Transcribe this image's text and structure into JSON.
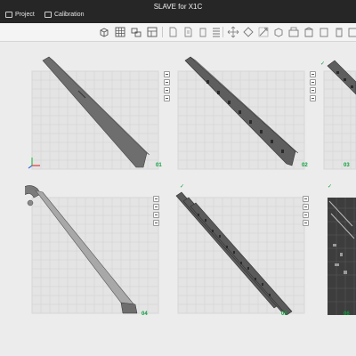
{
  "window": {
    "title": "SLAVE for X1C"
  },
  "tabs": [
    {
      "label": "Project"
    },
    {
      "label": "Calibration"
    }
  ],
  "plates": [
    {
      "number": "01"
    },
    {
      "number": "02"
    },
    {
      "number": "03"
    },
    {
      "number": "04"
    },
    {
      "number": "05"
    },
    {
      "number": "06"
    }
  ],
  "toolbar": {
    "tools": [
      "add-cube",
      "grid",
      "layout",
      "plates",
      "page",
      "page",
      "list",
      "separator",
      "move",
      "rotate",
      "scale",
      "cut",
      "support",
      "seam",
      "paint",
      "measure",
      "text",
      "assemble"
    ]
  },
  "colors": {
    "plate_number": "#0a9f3b",
    "titlebar": "#262626"
  }
}
